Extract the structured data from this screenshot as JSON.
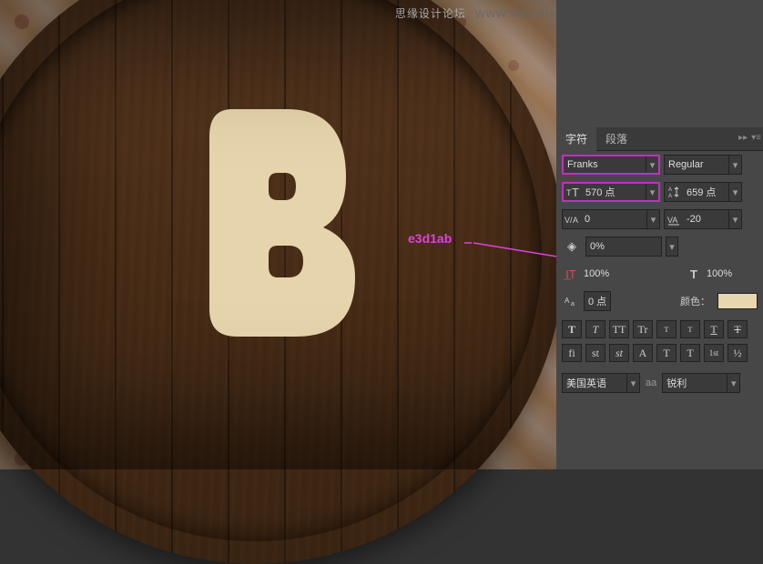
{
  "watermark": {
    "text": "思缘设计论坛",
    "url": "WWW.MISSYUAN.COM"
  },
  "annotation": {
    "color_hex": "e3d1ab"
  },
  "canvas": {
    "letter": "B"
  },
  "panel": {
    "tabs": {
      "char": "字符",
      "para": "段落"
    },
    "font_family": "Franks",
    "font_style": "Regular",
    "font_size": "570 点",
    "leading": "659 点",
    "kerning": "0",
    "tracking": "-20",
    "pct": "0%",
    "vscale": "100%",
    "hscale": "100%",
    "baseline": "0 点",
    "color_label": "颜色：",
    "color_value": "#e8d6b0",
    "buttons": {
      "bold": "T",
      "italic": "T",
      "allcaps": "TT",
      "smallcaps": "Tr",
      "super": "T",
      "sub": "T",
      "under": "T",
      "strike": "T",
      "fi": "fi",
      "st": "st",
      "swash": "st",
      "alt": "A",
      "titling": "T",
      "ord": "T",
      "frac": "1st",
      "half": "½"
    },
    "language": "美国英语",
    "aa_label": "aa",
    "aa_method": "锐利"
  }
}
